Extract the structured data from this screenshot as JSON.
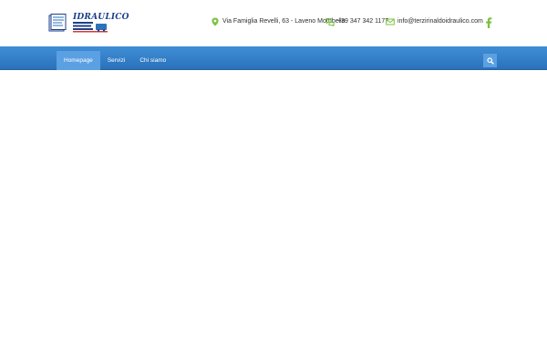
{
  "brand": {
    "logo_text": "IDRAULICO"
  },
  "contacts": {
    "address": "Via Famiglia Revelli, 63 - Laveno Mombello",
    "phone": "+39 347 342 1177",
    "email": "info@terzirinaldoidraulico.com"
  },
  "icons": {
    "address": "map-pin-icon",
    "phone": "chat-bubbles-icon",
    "email": "envelope-icon",
    "social": "facebook-icon",
    "search": "search-icon"
  },
  "nav": {
    "items": [
      {
        "label": "Homepage",
        "active": true
      },
      {
        "label": "Servizi",
        "active": false
      },
      {
        "label": "Chi siamo",
        "active": false
      }
    ]
  },
  "colors": {
    "accent_green": "#7cc142",
    "nav_blue": "#3584cb",
    "nav_active": "#5aa0e2",
    "logo_blue": "#1d3f8a"
  }
}
